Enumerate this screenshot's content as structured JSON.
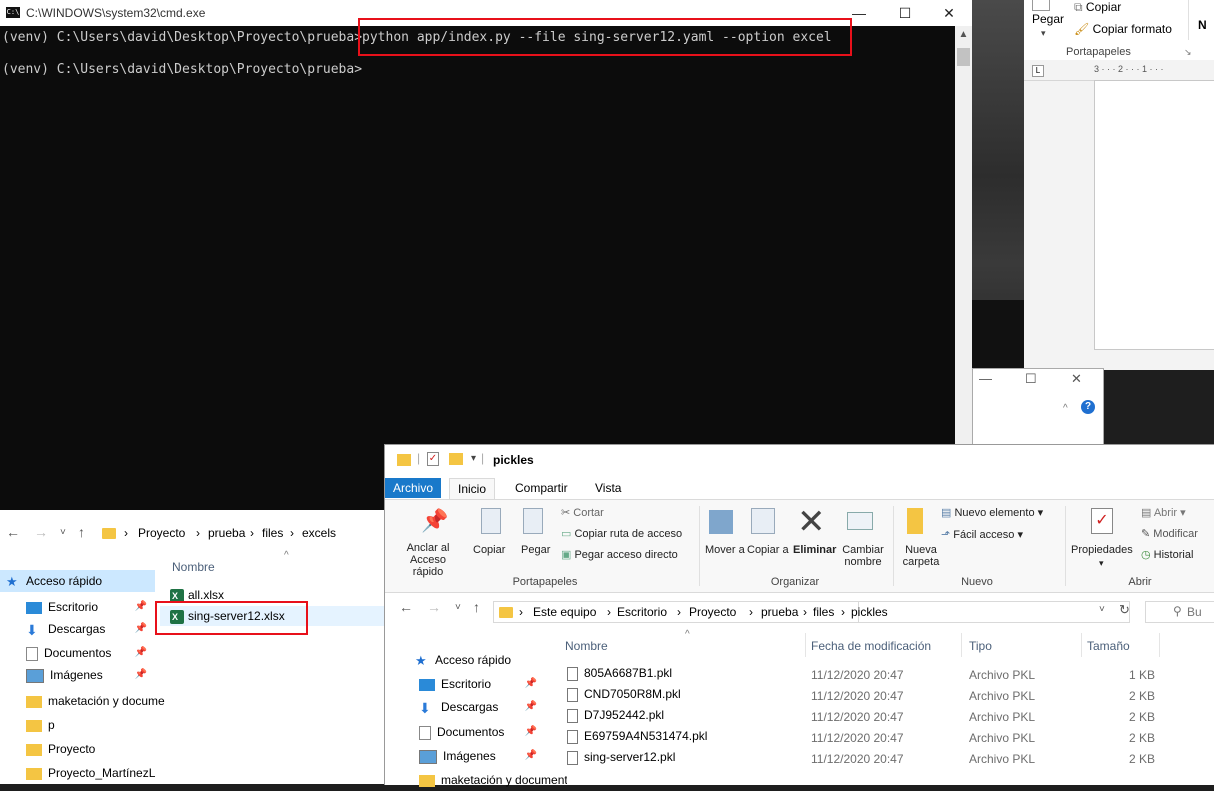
{
  "cmd": {
    "title": "C:\\WINDOWS\\system32\\cmd.exe",
    "icon_label": "C:\\",
    "line1_prompt": "(venv) C:\\Users\\david\\Desktop\\Proyecto\\prueba>",
    "line1_command": "python app/index.py --file sing-server12.yaml --option excel",
    "line2_prompt": "(venv) C:\\Users\\david\\Desktop\\Proyecto\\prueba>",
    "window_buttons": [
      "—",
      "☐",
      "✕"
    ]
  },
  "word": {
    "paste_label": "Pegar",
    "copy_label": "Copiar",
    "copy_format_label": "Copiar formato",
    "clipboard_group": "Portapapeles",
    "bold_label": "N",
    "ruler_text": "3 · · · 2 · · · 1 · · ·"
  },
  "small_dialog": {
    "buttons": [
      "—",
      "☐",
      "✕"
    ],
    "help": "?"
  },
  "excels_explorer": {
    "breadcrumb": [
      "Proyecto",
      "prueba",
      "files",
      "excels"
    ],
    "column_name": "Nombre",
    "nav": [
      {
        "label": "Acceso rápido",
        "icon": "star-icon",
        "pinned": false
      },
      {
        "label": "Escritorio",
        "icon": "desktop-icon",
        "pinned": true
      },
      {
        "label": "Descargas",
        "icon": "download-icon",
        "pinned": true
      },
      {
        "label": "Documentos",
        "icon": "documents-icon",
        "pinned": true
      },
      {
        "label": "Imágenes",
        "icon": "pictures-icon",
        "pinned": true
      },
      {
        "label": "maketación y documentación",
        "icon": "folder-icon",
        "pinned": false
      },
      {
        "label": "p",
        "icon": "folder-icon",
        "pinned": false
      },
      {
        "label": "Proyecto",
        "icon": "folder-icon",
        "pinned": false
      },
      {
        "label": "Proyecto_MartínezL",
        "icon": "folder-icon",
        "pinned": false
      }
    ],
    "files": [
      "all.xlsx",
      "sing-server12.xlsx"
    ]
  },
  "pickles_explorer": {
    "title": "pickles",
    "tabs": [
      "Archivo",
      "Inicio",
      "Compartir",
      "Vista"
    ],
    "ribbon": {
      "pin_label": "Anclar al Acceso rápido",
      "copy_label": "Copiar",
      "paste_label": "Pegar",
      "cut_label": "Cortar",
      "copy_path_label": "Copiar ruta de acceso",
      "paste_shortcut_label": "Pegar acceso directo",
      "clipboard_group": "Portapapeles",
      "move_label": "Mover a",
      "copy_to_label": "Copiar a",
      "delete_label": "Eliminar",
      "rename_label": "Cambiar nombre",
      "organize_group": "Organizar",
      "new_folder_label": "Nueva carpeta",
      "new_item_label": "Nuevo elemento",
      "easy_access_label": "Fácil acceso",
      "new_group": "Nuevo",
      "properties_label": "Propiedades",
      "open_label": "Abrir",
      "edit_label": "Modificar",
      "history_label": "Historial",
      "open_group": "Abrir"
    },
    "breadcrumb": [
      "Este equipo",
      "Escritorio",
      "Proyecto",
      "prueba",
      "files",
      "pickles"
    ],
    "search_placeholder": "Bu",
    "columns": [
      "Nombre",
      "Fecha de modificación",
      "Tipo",
      "Tamaño"
    ],
    "nav": [
      {
        "label": "Acceso rápido",
        "icon": "star-icon",
        "pinned": false
      },
      {
        "label": "Escritorio",
        "icon": "desktop-icon",
        "pinned": true
      },
      {
        "label": "Descargas",
        "icon": "download-icon",
        "pinned": true
      },
      {
        "label": "Documentos",
        "icon": "documents-icon",
        "pinned": true
      },
      {
        "label": "Imágenes",
        "icon": "pictures-icon",
        "pinned": true
      },
      {
        "label": "maketación y documentación",
        "icon": "folder-icon",
        "pinned": false
      }
    ],
    "files": [
      {
        "name": "805A6687B1.pkl",
        "date": "11/12/2020 20:47",
        "type": "Archivo PKL",
        "size": "1 KB"
      },
      {
        "name": "CND7050R8M.pkl",
        "date": "11/12/2020 20:47",
        "type": "Archivo PKL",
        "size": "2 KB"
      },
      {
        "name": "D7J952442.pkl",
        "date": "11/12/2020 20:47",
        "type": "Archivo PKL",
        "size": "2 KB"
      },
      {
        "name": "E69759A4N531474.pkl",
        "date": "11/12/2020 20:47",
        "type": "Archivo PKL",
        "size": "2 KB"
      },
      {
        "name": "sing-server12.pkl",
        "date": "11/12/2020 20:47",
        "type": "Archivo PKL",
        "size": "2 KB"
      }
    ]
  },
  "colors": {
    "highlight": "#e8101a",
    "file_tab": "#1979ca",
    "selection": "#cce8ff",
    "folder": "#f4c543"
  }
}
